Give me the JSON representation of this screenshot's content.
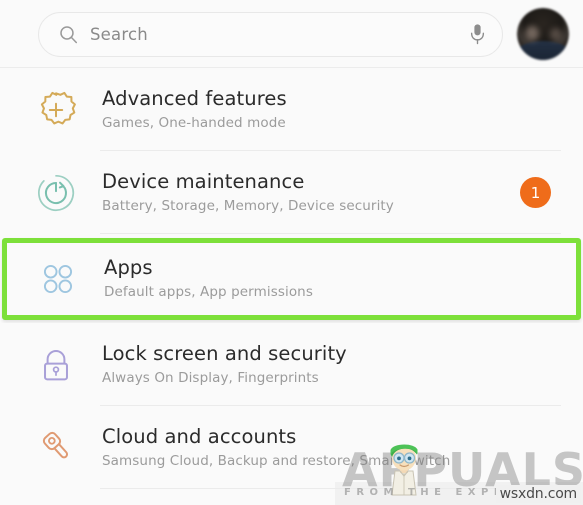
{
  "header": {
    "search": {
      "placeholder": "Search",
      "value": "",
      "search_icon": "search-icon",
      "mic_icon": "microphone-icon"
    },
    "avatar": {
      "name": "user-avatar"
    }
  },
  "settings_list": {
    "items": [
      {
        "id": "advanced-features",
        "title": "Advanced features",
        "subtitle": "Games, One-handed mode",
        "icon": "gear-plus-icon",
        "icon_color": "#d4aa58",
        "badge": null,
        "highlighted": false
      },
      {
        "id": "device-maintenance",
        "title": "Device maintenance",
        "subtitle": "Battery, Storage, Memory, Device security",
        "icon": "refresh-circle-icon",
        "icon_color": "#79bfae",
        "badge": "1",
        "highlighted": false
      },
      {
        "id": "apps",
        "title": "Apps",
        "subtitle": "Default apps, App permissions",
        "icon": "apps-grid-icon",
        "icon_color": "#9ec6e0",
        "badge": null,
        "highlighted": true
      },
      {
        "id": "lock-screen-and-security",
        "title": "Lock screen and security",
        "subtitle": "Always On Display, Fingerprints",
        "icon": "padlock-icon",
        "icon_color": "#a9a0d8",
        "badge": null,
        "highlighted": false
      },
      {
        "id": "cloud-and-accounts",
        "title": "Cloud and accounts",
        "subtitle": "Samsung Cloud, Backup and restore, Smart Switch",
        "icon": "key-icon",
        "icon_color": "#e09a72",
        "badge": null,
        "highlighted": false
      }
    ]
  },
  "watermark": {
    "brand": "APPUALS",
    "tagline": "FROM THE EXPERTS",
    "site": "wsxdn.com",
    "mascot": "mascot-icon"
  },
  "colors": {
    "highlight_green": "#7de03a",
    "badge_orange": "#ef6c1a",
    "background": "#fafafa",
    "title_text": "#2b2b2b",
    "subtitle_text": "#9b9b9b"
  }
}
